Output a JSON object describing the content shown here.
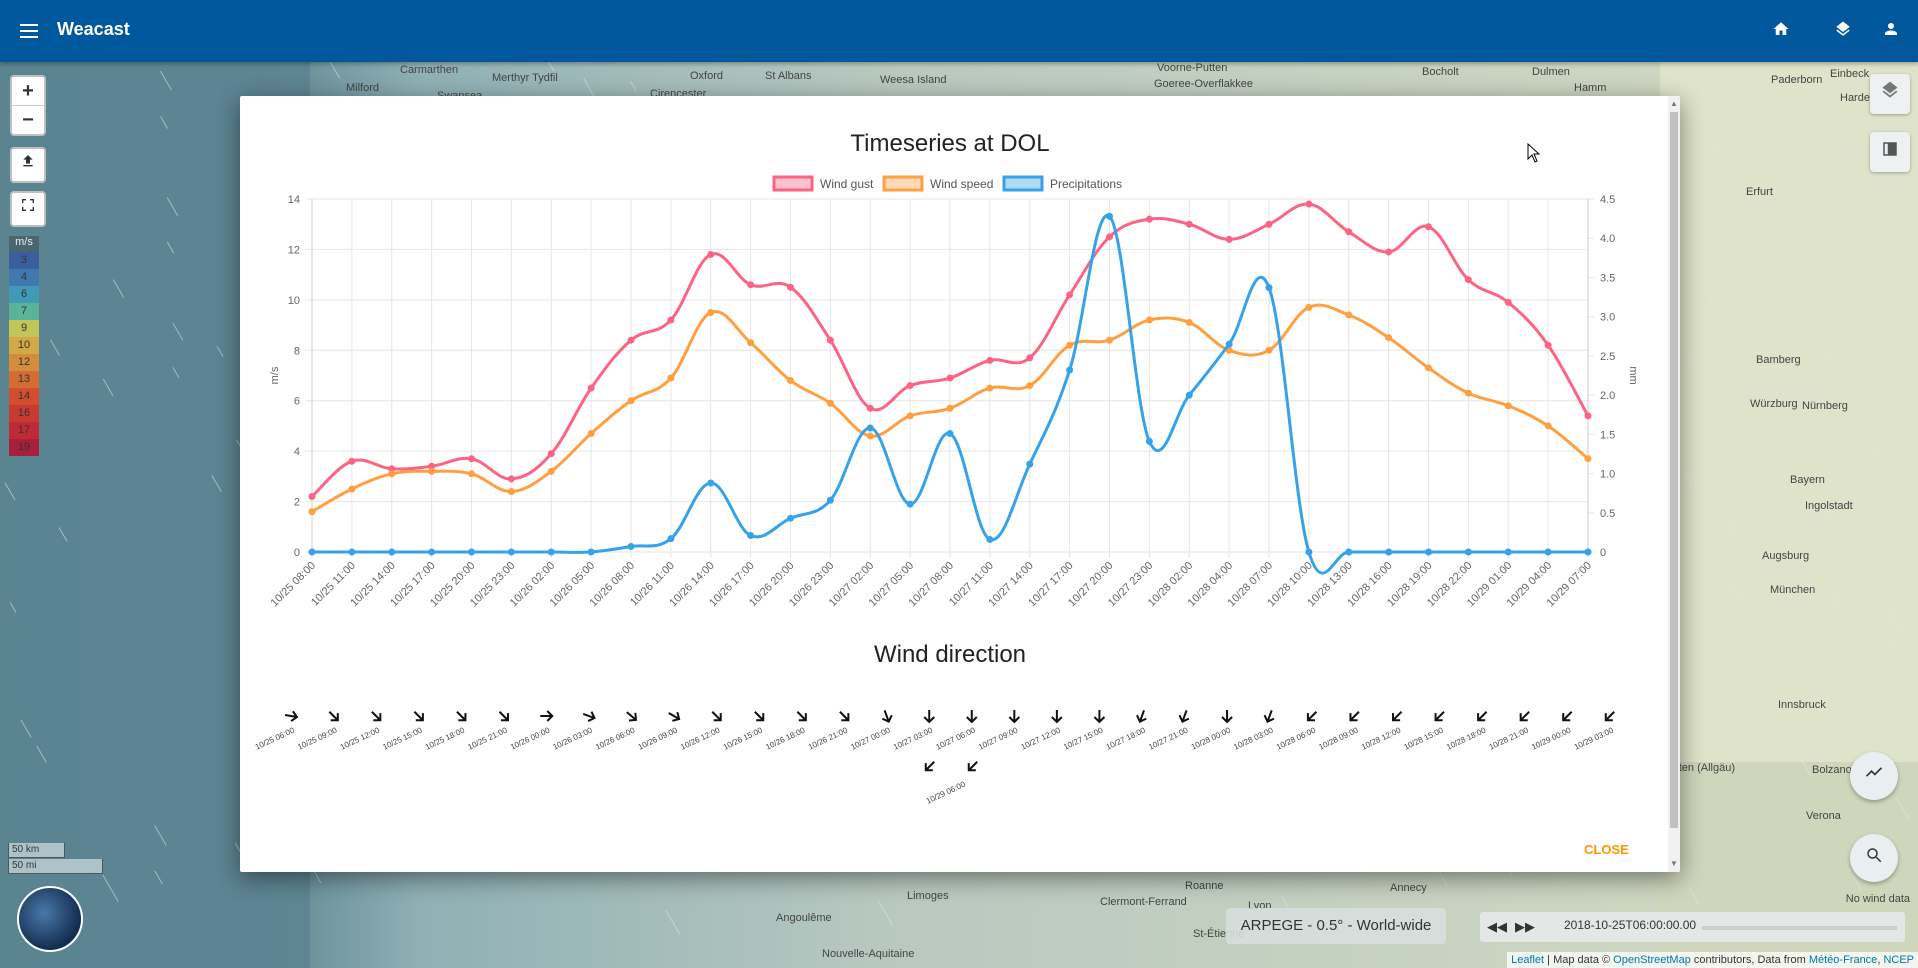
{
  "app": {
    "title": "Weacast"
  },
  "colors": {
    "topbar": "#01579b",
    "wind_gust": "#ff6384",
    "wind_speed": "#ff9f40",
    "precipitations": "#36a2eb",
    "close": "#ff9800"
  },
  "icons": {
    "menu": "menu-icon",
    "home": "home-icon",
    "layers": "layers-icon",
    "account": "account-icon"
  },
  "map_controls": {
    "zoom_in": "+",
    "zoom_out": "−"
  },
  "legend": {
    "unit": "m/s",
    "values": [
      "3",
      "4",
      "6",
      "7",
      "9",
      "10",
      "12",
      "13",
      "14",
      "16",
      "17",
      "19"
    ],
    "colors": [
      "#3b5f9e",
      "#3f79b0",
      "#3e9ab5",
      "#5bb39a",
      "#c2c65a",
      "#d2a947",
      "#d48d3d",
      "#d36d34",
      "#d14f2e",
      "#c93a32",
      "#c02a36",
      "#a91e3a"
    ]
  },
  "scale": {
    "km": "50 km",
    "mi": "50 mi"
  },
  "cities": [
    {
      "name": "Carmarthen"
    },
    {
      "name": "Oxford"
    },
    {
      "name": "St Albans"
    },
    {
      "name": "Milford"
    },
    {
      "name": "Merthyr Tydfil"
    },
    {
      "name": "Swansea"
    },
    {
      "name": "Cirencester"
    },
    {
      "name": "Weesa Island"
    },
    {
      "name": "Voorne-Putten"
    },
    {
      "name": "Goeree-Overflakkee"
    },
    {
      "name": "Bocholt"
    },
    {
      "name": "Dulmen"
    },
    {
      "name": "Hamm"
    },
    {
      "name": "Paderborn"
    },
    {
      "name": "Einbeck"
    },
    {
      "name": "Hardegsen"
    },
    {
      "name": "Erfurt"
    },
    {
      "name": "Nürnberg"
    },
    {
      "name": "Bamberg"
    },
    {
      "name": "Würzburg"
    },
    {
      "name": "Augsburg"
    },
    {
      "name": "München"
    },
    {
      "name": "Ingolstadt"
    },
    {
      "name": "Bolzano - Bozen"
    },
    {
      "name": "Innsbruck"
    },
    {
      "name": "Verona"
    },
    {
      "name": "Limoges"
    },
    {
      "name": "Clermont-Ferrand"
    },
    {
      "name": "Lyon"
    },
    {
      "name": "Annecy"
    },
    {
      "name": "Angoulême"
    },
    {
      "name": "Nouvelle-Aquitaine"
    },
    {
      "name": "Roanne"
    },
    {
      "name": "St-Étienne"
    },
    {
      "name": "Kempten (Allgäu)"
    },
    {
      "name": "Bayern"
    }
  ],
  "forecast_model": "ARPEGE - 0.5° - World-wide",
  "time_control": {
    "datetime": "2018-10-25T06:00:00.00"
  },
  "no_wind_data": "No wind data",
  "attribution": {
    "leaflet": "Leaflet",
    "map_data": " | Map data © ",
    "osm": "OpenStreetMap",
    "contributors": " contributors, Data from ",
    "meteo": "Météo-France",
    "sep": ", ",
    "ncep": "NCEP"
  },
  "modal": {
    "close_label": "CLOSE"
  },
  "chart_data": [
    {
      "type": "line",
      "title": "Timeseries at DOL",
      "ylabel": "m/s",
      "y2label": "mm",
      "ylim": [
        0,
        14
      ],
      "y2lim": [
        0,
        4.5
      ],
      "yticks": [
        0,
        2,
        4,
        6,
        8,
        10,
        12,
        14
      ],
      "y2ticks": [
        "0",
        "0.5",
        "1.0",
        "1.5",
        "2.0",
        "2.5",
        "3.0",
        "3.5",
        "4.0",
        "4.5"
      ],
      "legend_position": "top",
      "grid": true,
      "categories": [
        "10/25 08:00",
        "10/25 11:00",
        "10/25 14:00",
        "10/25 17:00",
        "10/25 20:00",
        "10/25 23:00",
        "10/26 02:00",
        "10/26 05:00",
        "10/26 08:00",
        "10/26 11:00",
        "10/26 14:00",
        "10/26 17:00",
        "10/26 20:00",
        "10/26 23:00",
        "10/27 02:00",
        "10/27 05:00",
        "10/27 08:00",
        "10/27 11:00",
        "10/27 14:00",
        "10/27 17:00",
        "10/27 20:00",
        "10/27 23:00",
        "10/28 02:00",
        "10/28 04:00",
        "10/28 07:00",
        "10/28 10:00",
        "10/28 13:00",
        "10/28 16:00",
        "10/28 19:00",
        "10/28 22:00",
        "10/29 01:00",
        "10/29 04:00",
        "10/29 07:00"
      ],
      "series": [
        {
          "name": "Wind gust",
          "axis": "left",
          "values": [
            2.2,
            3.6,
            3.3,
            3.4,
            3.7,
            2.9,
            3.9,
            6.5,
            8.4,
            9.2,
            11.8,
            10.6,
            10.5,
            8.4,
            5.7,
            6.6,
            6.9,
            7.6,
            7.7,
            10.2,
            12.5,
            13.2,
            13.0,
            12.4,
            13.0,
            13.8,
            12.7,
            11.9,
            12.9,
            10.8,
            9.9,
            8.2,
            5.4
          ]
        },
        {
          "name": "Wind speed",
          "axis": "left",
          "values": [
            1.6,
            2.5,
            3.1,
            3.2,
            3.1,
            2.4,
            3.2,
            4.7,
            6.0,
            6.9,
            9.5,
            8.3,
            6.8,
            5.9,
            4.6,
            5.4,
            5.7,
            6.5,
            6.6,
            8.2,
            8.4,
            9.2,
            9.1,
            8.0,
            8.0,
            9.7,
            9.4,
            8.5,
            7.3,
            6.3,
            5.8,
            5.0,
            3.7
          ]
        },
        {
          "name": "Precipitations",
          "axis": "right",
          "values": [
            0,
            0,
            0,
            0,
            0,
            0,
            0,
            0,
            0.07,
            0.17,
            0.88,
            0.21,
            0.43,
            0.66,
            1.58,
            0.61,
            1.51,
            0.16,
            1.12,
            2.32,
            4.28,
            1.41,
            2.0,
            2.65,
            3.37,
            0,
            0,
            0,
            0,
            0,
            0,
            0,
            0
          ]
        }
      ]
    },
    {
      "type": "scatter",
      "title": "Wind direction",
      "categories": [
        "10/25 06:00",
        "10/25 09:00",
        "10/25 12:00",
        "10/25 15:00",
        "10/25 18:00",
        "10/25 21:00",
        "10/26 00:00",
        "10/26 03:00",
        "10/26 06:00",
        "10/26 09:00",
        "10/26 12:00",
        "10/26 15:00",
        "10/26 18:00",
        "10/26 21:00",
        "10/27 00:00",
        "10/27 03:00",
        "10/27 06:00",
        "10/27 09:00",
        "10/27 12:00",
        "10/27 15:00",
        "10/27 18:00",
        "10/27 21:00",
        "10/28 00:00",
        "10/28 03:00",
        "10/28 06:00",
        "10/28 09:00",
        "10/28 12:00",
        "10/28 15:00",
        "10/28 18:00",
        "10/28 21:00",
        "10/29 00:00",
        "10/29 03:00"
      ],
      "arrow_rotation_deg": [
        100,
        135,
        135,
        135,
        135,
        135,
        90,
        110,
        130,
        120,
        135,
        135,
        135,
        135,
        160,
        180,
        180,
        180,
        180,
        180,
        200,
        200,
        180,
        200,
        225,
        225,
        225,
        225,
        225,
        225,
        225,
        225
      ],
      "overflow_categories": [
        "10/29 06:00"
      ],
      "overflow_arrow_rotation_deg": [
        225,
        225
      ]
    }
  ]
}
